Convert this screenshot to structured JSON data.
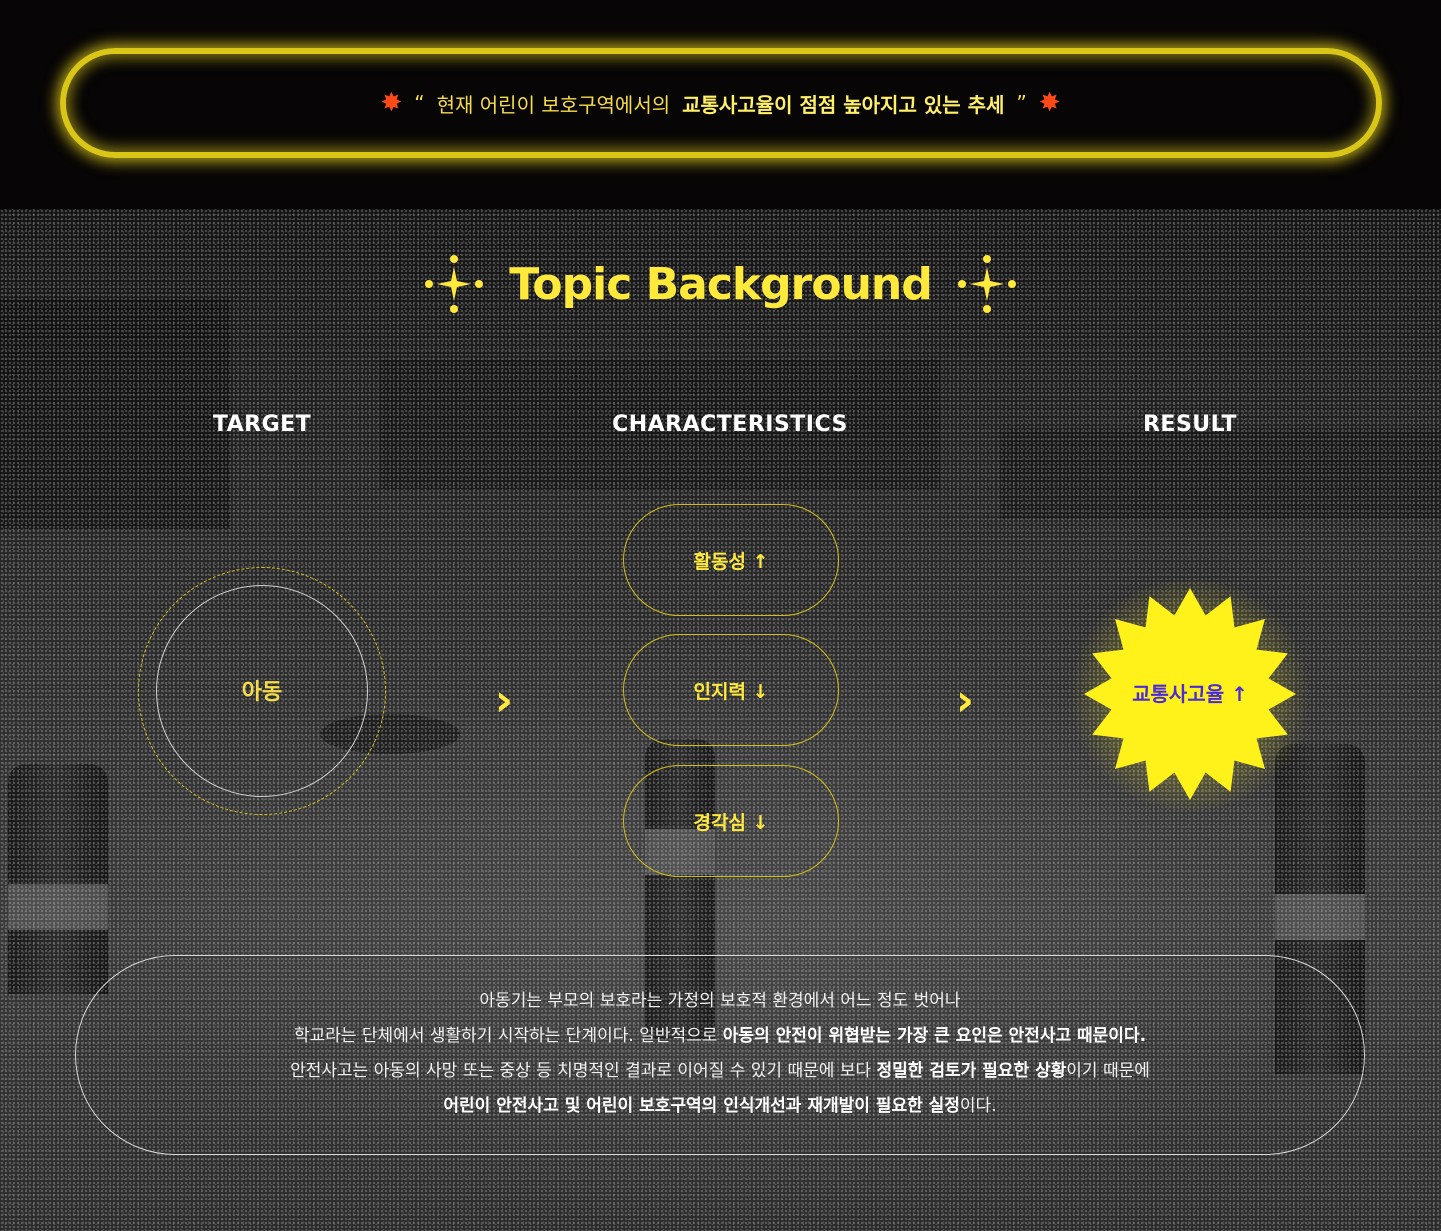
{
  "banner": {
    "quote_open": "“",
    "text_plain": "현재 어린이 보호구역에서의",
    "text_bold": "교통사고율이 점점 높아지고 있는 추세",
    "quote_close": "”",
    "star_glyph": "✸",
    "star_color": "#ff4a18",
    "glow_color": "#e8d41e"
  },
  "title": "Topic Background",
  "columns": {
    "target": {
      "heading": "TARGET",
      "label": "아동"
    },
    "characteristics": {
      "heading": "CHARACTERISTICS",
      "items": [
        {
          "label": "활동성 ↑"
        },
        {
          "label": "인지력 ↓"
        },
        {
          "label": "경각심 ↓"
        }
      ]
    },
    "result": {
      "heading": "RESULT",
      "label": "교통사고율 ↑",
      "burst_color": "#fff21a",
      "label_color": "#4a2bd6"
    }
  },
  "arrow_glyph": "›",
  "description": {
    "line1": "아동기는 부모의 보호라는 가정의 보호적 환경에서 어느 정도 벗어나",
    "line2_plain": "학교라는 단체에서 생활하기 시작하는 단계이다. 일반적으로",
    "line2_bold": "아동의 안전이 위협받는 가장 큰 요인은 안전사고 때문이다.",
    "line3_plain": "안전사고는 아동의 사망 또는 중상 등 치명적인 결과로 이어질 수 있기 때문에 보다",
    "line3_bold": "정밀한 검토가 필요한 상황",
    "line3_tail": "이기 때문에",
    "line4_bold": "어린이 안전사고 및 어린이 보호구역의 인식개선과 재개발이 필요한 실정",
    "line4_tail": "이다."
  },
  "accent_color": "#ffe93a"
}
